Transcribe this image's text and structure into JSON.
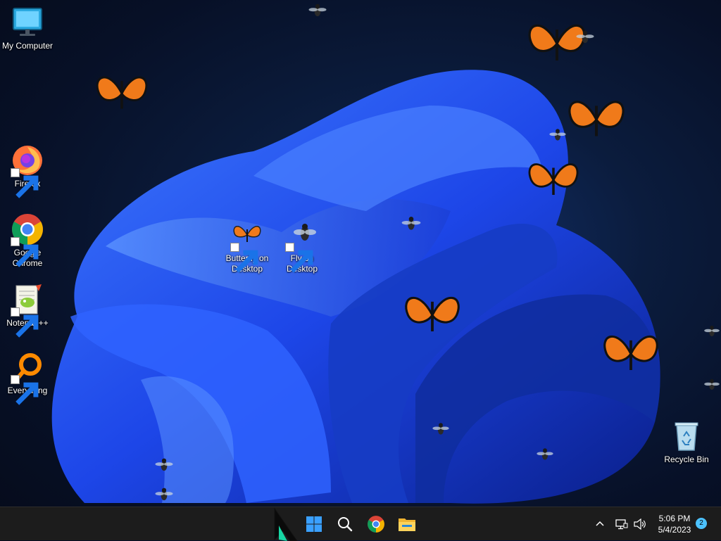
{
  "desktop": {
    "icons": [
      {
        "label": "My Computer",
        "icon": "monitor-icon"
      },
      {
        "label": "Firefox",
        "icon": "firefox-icon",
        "shortcut": true
      },
      {
        "label": "Google Chrome",
        "icon": "chrome-icon",
        "shortcut": true
      },
      {
        "label": "Notepad++",
        "icon": "notepadpp-icon",
        "shortcut": true
      },
      {
        "label": "Everything",
        "icon": "everything-search-icon",
        "shortcut": true
      },
      {
        "label": "Butterfly on Desktop",
        "icon": "butterfly-icon",
        "shortcut": true
      },
      {
        "label": "Fly on Desktop",
        "icon": "fly-icon",
        "shortcut": true
      },
      {
        "label": "Recycle Bin",
        "icon": "recycle-bin-icon"
      }
    ]
  },
  "taskbar": {
    "pinned": [
      "windows-start-icon",
      "search-icon",
      "chrome-icon",
      "file-explorer-icon"
    ],
    "tray": {
      "icons": [
        "chevron-up-icon",
        "network-icon",
        "volume-icon"
      ],
      "time": "5:06 PM",
      "date": "5/4/2023",
      "notification_count": "2"
    }
  },
  "colors": {
    "taskbar": "#1c1c1c",
    "accent": "#4cc2ff",
    "butterfly": "#f07a1a",
    "bloom": "#1f4fe0"
  }
}
